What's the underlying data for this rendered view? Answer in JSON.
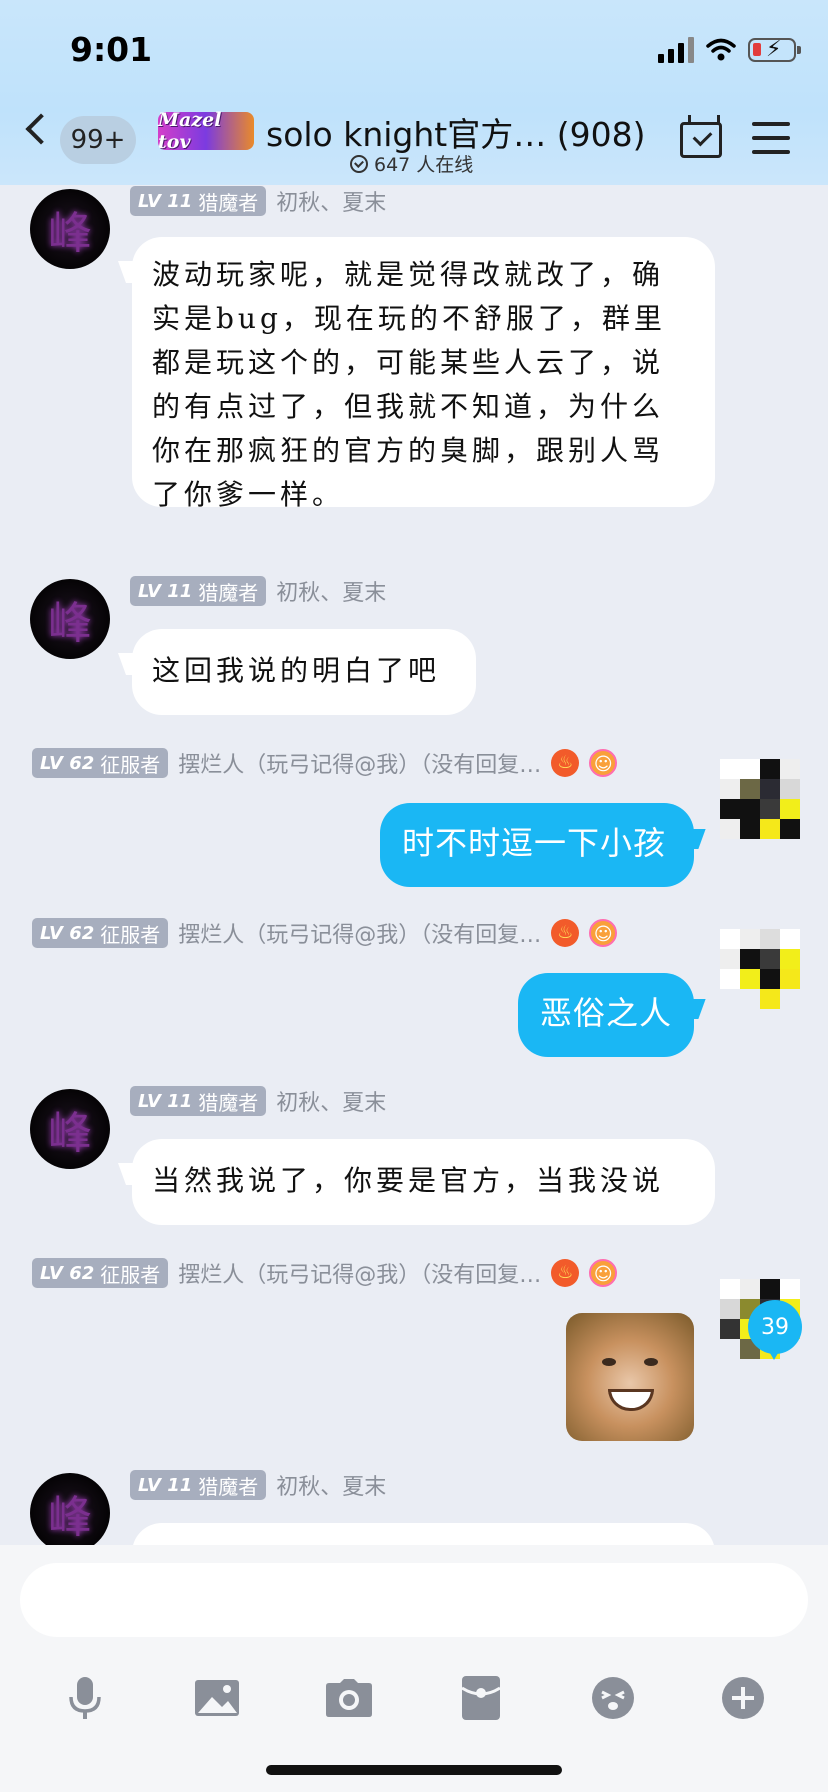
{
  "status_bar": {
    "time": "9:01"
  },
  "header": {
    "unread_count": "99+",
    "logo_text": "Mazel tov",
    "title": "solo knight官方… (908)",
    "online": "647 人在线"
  },
  "messages": [
    {
      "sender": "初秋、夏末",
      "level": "LV 11",
      "title": "猎魔者",
      "side": "left",
      "avatar_glyph": "峰",
      "lines": [
        "波动玩家呢，就是觉得改就改了，确",
        "实是bug，现在玩的不舒服了，群里",
        "都是玩这个的，可能某些人云了，说",
        "的有点过了，但我就不知道，为什么",
        "你在那疯狂的官方的臭脚，跟别人骂",
        "了你爹一样。"
      ]
    },
    {
      "sender": "初秋、夏末",
      "level": "LV 11",
      "title": "猎魔者",
      "side": "left",
      "avatar_glyph": "峰",
      "lines": [
        "这回我说的明白了吧"
      ]
    },
    {
      "sender": "摆烂人（玩弓记得@我）（没有回复…",
      "level": "LV 62",
      "title": "征服者",
      "side": "right",
      "lines": [
        "时不时逗一下小孩"
      ]
    },
    {
      "sender": "摆烂人（玩弓记得@我）（没有回复…",
      "level": "LV 62",
      "title": "征服者",
      "side": "right",
      "lines": [
        "恶俗之人"
      ]
    },
    {
      "sender": "初秋、夏末",
      "level": "LV 11",
      "title": "猎魔者",
      "side": "left",
      "avatar_glyph": "峰",
      "lines": [
        "当然我说了，你要是官方，当我没说"
      ]
    },
    {
      "sender": "摆烂人（玩弓记得@我）（没有回复…",
      "level": "LV 62",
      "title": "征服者",
      "side": "right",
      "lines": []
    },
    {
      "sender": "初秋、夏末",
      "level": "LV 11",
      "title": "猎魔者",
      "side": "left",
      "avatar_glyph": "峰",
      "lines": []
    }
  ],
  "new_message_count": "39",
  "input": {
    "value": ""
  },
  "toolbar": {
    "icons": [
      "microphone-icon",
      "image-icon",
      "camera-icon",
      "red-packet-icon",
      "emoji-icon",
      "plus-icon"
    ]
  },
  "colors": {
    "bubble_mine": "#1ab7f4",
    "header_bg": "#c9e6fb",
    "chat_bg": "#eaedf4"
  }
}
